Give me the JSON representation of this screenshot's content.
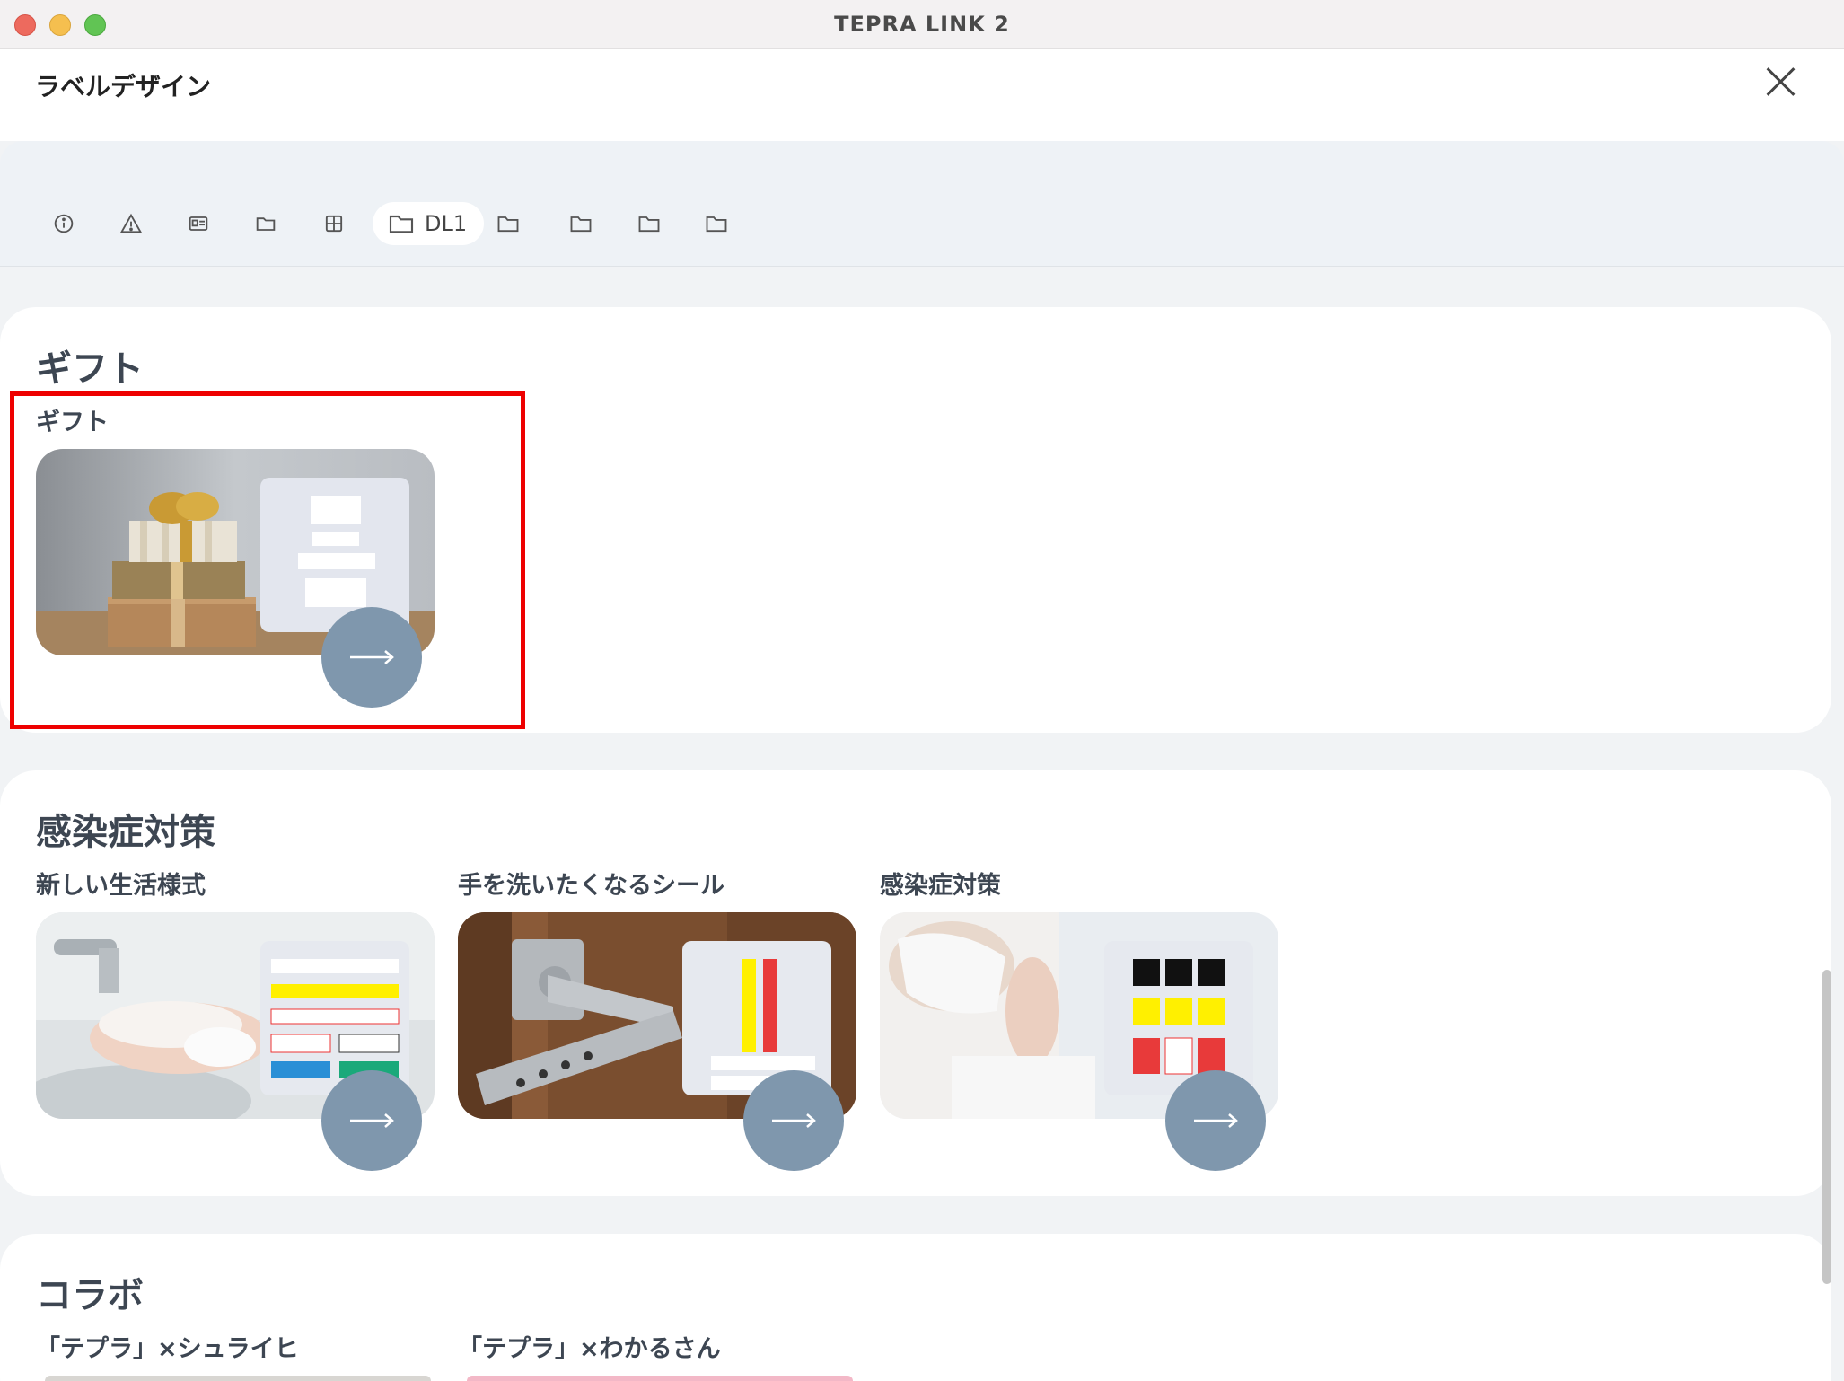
{
  "window": {
    "title": "TEPRA LINK 2"
  },
  "header": {
    "title": "ラベルデザイン"
  },
  "tabs": [
    {
      "icon": "info-icon"
    },
    {
      "icon": "warning-icon"
    },
    {
      "icon": "id-card-icon"
    },
    {
      "icon": "folder-icon"
    },
    {
      "icon": "grid-icon"
    },
    {
      "icon": "folder-icon",
      "label": "DL1",
      "active": true
    },
    {
      "icon": "folder-icon"
    },
    {
      "icon": "folder-icon"
    },
    {
      "icon": "folder-icon"
    },
    {
      "icon": "folder-icon"
    }
  ],
  "sections": {
    "gift": {
      "title": "ギフト",
      "cards": [
        {
          "title": "ギフト"
        }
      ]
    },
    "infection": {
      "title": "感染症対策",
      "cards": [
        {
          "title": "新しい生活様式"
        },
        {
          "title": "手を洗いたくなるシール"
        },
        {
          "title": "感染症対策"
        }
      ]
    },
    "collab": {
      "title": "コラボ",
      "cards": [
        {
          "title": "「テプラ」×シュライヒ"
        },
        {
          "title": "「テプラ」×わかるさん"
        }
      ]
    }
  },
  "colors": {
    "accent_button": "#7f97ad",
    "highlight": "#ee0000"
  }
}
